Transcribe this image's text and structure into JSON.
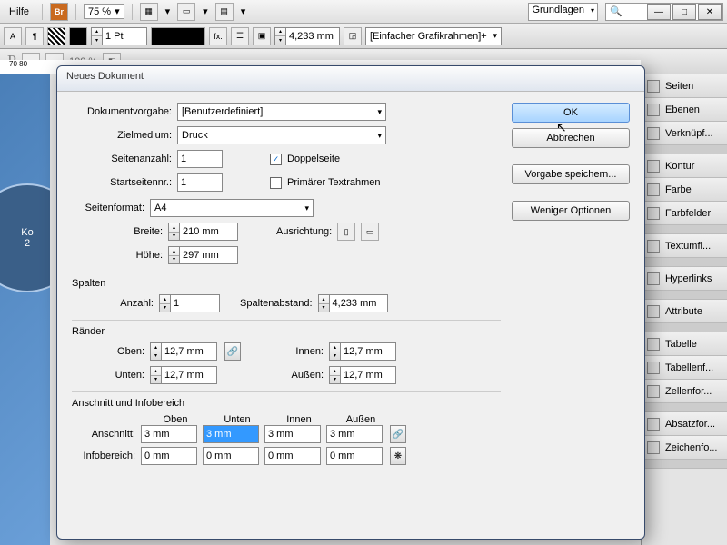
{
  "menubar": {
    "help": "Hilfe",
    "br": "Br",
    "zoom": "75 %",
    "layout": "Grundlagen"
  },
  "toolbar": {
    "stroke": "1 Pt",
    "measure": "4,233 mm",
    "frame": "[Einfacher Grafikrahmen]+",
    "pct": "100 %"
  },
  "ruler": "70      80",
  "canvas": {
    "t1": "Ko",
    "t2": "2"
  },
  "panels": [
    "Seiten",
    "Ebenen",
    "Verknüpf...",
    "Kontur",
    "Farbe",
    "Farbfelder",
    "Textumfl...",
    "Hyperlinks",
    "Attribute",
    "Tabelle",
    "Tabellenf...",
    "Zellenfor...",
    "Absatzfor...",
    "Zeichenfo..."
  ],
  "dialog": {
    "title": "Neues Dokument",
    "presetLabel": "Dokumentvorgabe:",
    "preset": "[Benutzerdefiniert]",
    "intentLabel": "Zielmedium:",
    "intent": "Druck",
    "pagesLabel": "Seitenanzahl:",
    "pages": "1",
    "startLabel": "Startseitennr.:",
    "start": "1",
    "facing": "Doppelseite",
    "primaryFrame": "Primärer Textrahmen",
    "sizeLabel": "Seitenformat:",
    "size": "A4",
    "widthLabel": "Breite:",
    "width": "210 mm",
    "heightLabel": "Höhe:",
    "height": "297 mm",
    "orientLabel": "Ausrichtung:",
    "colsTitle": "Spalten",
    "colsCountLabel": "Anzahl:",
    "colsCount": "1",
    "colsGutterLabel": "Spaltenabstand:",
    "colsGutter": "4,233 mm",
    "marginsTitle": "Ränder",
    "mTop": "Oben:",
    "mBottom": "Unten:",
    "mInside": "Innen:",
    "mOutside": "Außen:",
    "mTopV": "12,7 mm",
    "mBottomV": "12,7 mm",
    "mInsideV": "12,7 mm",
    "mOutsideV": "12,7 mm",
    "bleedTitle": "Anschnitt und Infobereich",
    "hTop": "Oben",
    "hBottom": "Unten",
    "hInside": "Innen",
    "hOutside": "Außen",
    "bleedLabel": "Anschnitt:",
    "slugLabel": "Infobereich:",
    "bleed": [
      "3 mm",
      "3 mm",
      "3 mm",
      "3 mm"
    ],
    "slug": [
      "0 mm",
      "0 mm",
      "0 mm",
      "0 mm"
    ],
    "ok": "OK",
    "cancel": "Abbrechen",
    "save": "Vorgabe speichern...",
    "fewer": "Weniger Optionen"
  }
}
